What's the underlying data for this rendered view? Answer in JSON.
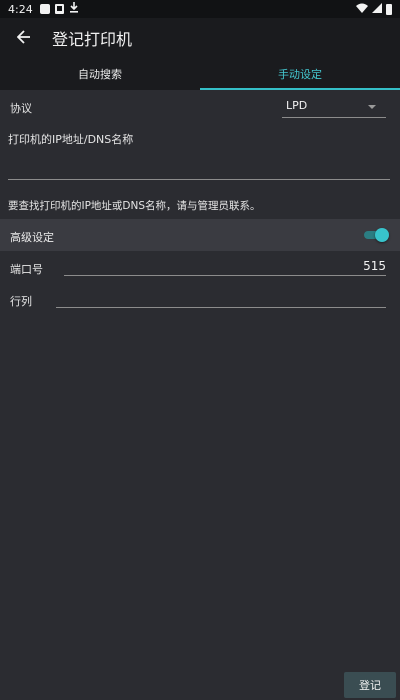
{
  "status_bar": {
    "time": "4:24",
    "icons": [
      "notification-square-icon",
      "photo-icon",
      "download-icon",
      "wifi-icon",
      "signal-icon",
      "battery-icon"
    ]
  },
  "app_bar": {
    "back_icon": "arrow-left-icon",
    "title": "登记打印机"
  },
  "tabs": [
    {
      "label": "自动搜索",
      "active": false
    },
    {
      "label": "手动设定",
      "active": true
    }
  ],
  "form": {
    "protocol_label": "协议",
    "protocol_value": "LPD",
    "ip_label": "打印机的IP地址/DNS名称",
    "ip_value": "",
    "help_text": "要查找打印机的IP地址或DNS名称，请与管理员联系。",
    "advanced_label": "高级设定",
    "advanced_enabled": true,
    "port_label": "端口号",
    "port_value": "515",
    "queue_label": "行列",
    "queue_value": ""
  },
  "footer": {
    "register_label": "登记"
  },
  "colors": {
    "accent": "#35c0c8",
    "background": "#2b2c31",
    "app_bar": "#1a1b1e",
    "section_row": "#3a3b41",
    "button_bg": "#3a4d52"
  }
}
